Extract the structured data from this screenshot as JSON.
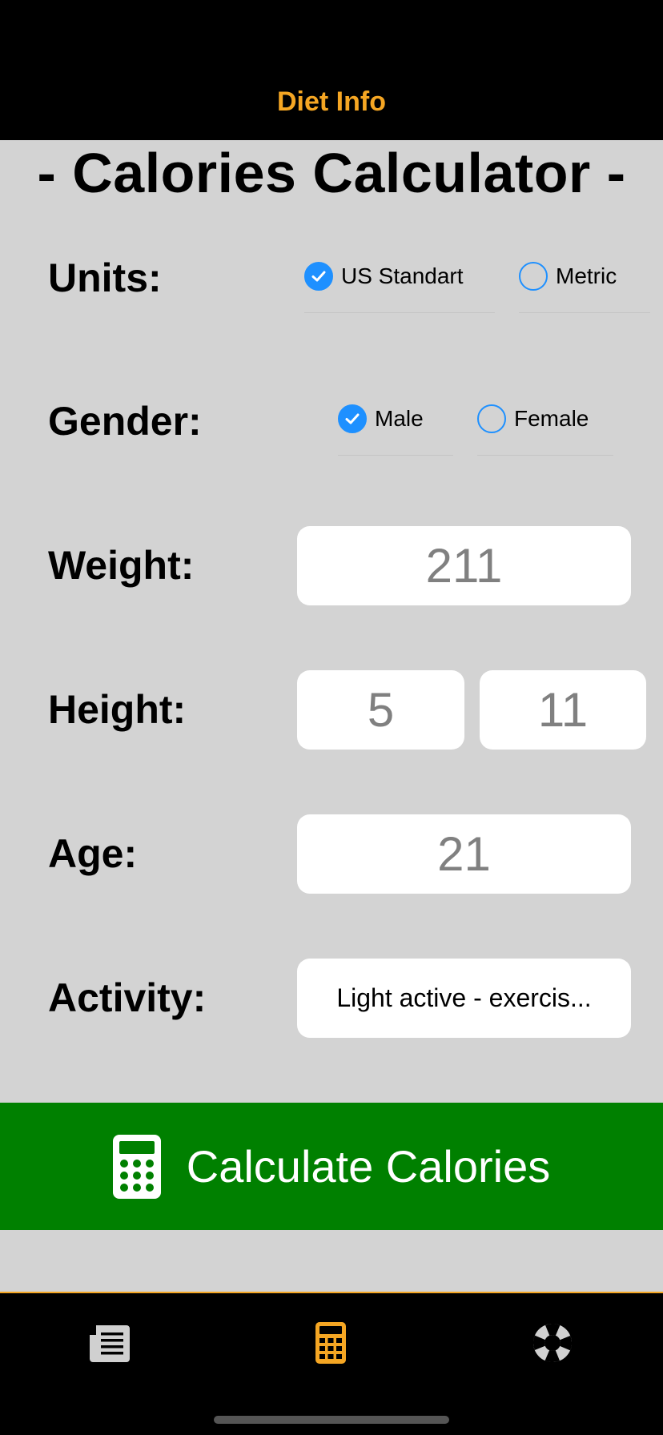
{
  "nav": {
    "title": "Diet Info"
  },
  "heading": "- Calories Calculator -",
  "units": {
    "label": "Units:",
    "options": [
      {
        "label": "US Standart",
        "checked": true
      },
      {
        "label": "Metric",
        "checked": false
      }
    ]
  },
  "gender": {
    "label": "Gender:",
    "options": [
      {
        "label": "Male",
        "checked": true
      },
      {
        "label": "Female",
        "checked": false
      }
    ]
  },
  "weight": {
    "label": "Weight:",
    "value": "211"
  },
  "height": {
    "label": "Height:",
    "feet": "5",
    "inches": "11"
  },
  "age": {
    "label": "Age:",
    "value": "21"
  },
  "activity": {
    "label": "Activity:",
    "value": "Light active - exercis..."
  },
  "calculate_button": {
    "label": "Calculate Calories",
    "icon": "calculator-icon"
  },
  "tabbar": {
    "tabs": [
      {
        "icon": "article-icon",
        "active": false
      },
      {
        "icon": "calculator-icon",
        "active": true
      },
      {
        "icon": "lifebuoy-icon",
        "active": false
      }
    ]
  },
  "colors": {
    "accent": "#f5a623",
    "button": "#008000",
    "radio": "#1e90ff",
    "background": "#d3d3d3"
  }
}
